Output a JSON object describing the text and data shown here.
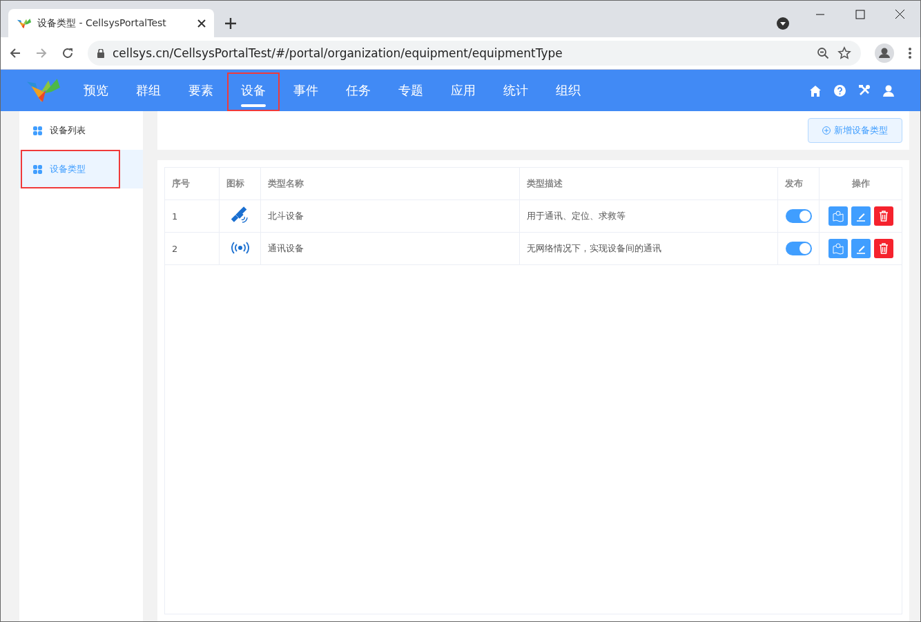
{
  "browser": {
    "tab_title": "设备类型 - CellsysPortalTest",
    "url": "cellsys.cn/CellsysPortalTest/#/portal/organization/equipment/equipmentType"
  },
  "nav": {
    "items": [
      {
        "label": "预览",
        "selected": false,
        "highlighted": false
      },
      {
        "label": "群组",
        "selected": false,
        "highlighted": false
      },
      {
        "label": "要素",
        "selected": false,
        "highlighted": false
      },
      {
        "label": "设备",
        "selected": true,
        "highlighted": true
      },
      {
        "label": "事件",
        "selected": false,
        "highlighted": false
      },
      {
        "label": "任务",
        "selected": false,
        "highlighted": false
      },
      {
        "label": "专题",
        "selected": false,
        "highlighted": false
      },
      {
        "label": "应用",
        "selected": false,
        "highlighted": false
      },
      {
        "label": "统计",
        "selected": false,
        "highlighted": false
      },
      {
        "label": "组织",
        "selected": false,
        "highlighted": false
      }
    ]
  },
  "sidebar": {
    "items": [
      {
        "label": "设备列表",
        "selected": false,
        "highlighted": false
      },
      {
        "label": "设备类型",
        "selected": true,
        "highlighted": true
      }
    ]
  },
  "toolbar": {
    "add_button": "新增设备类型"
  },
  "table": {
    "columns": [
      "序号",
      "图标",
      "类型名称",
      "类型描述",
      "发布",
      "操作"
    ],
    "rows": [
      {
        "index": "1",
        "kind": "satellite",
        "name": "北斗设备",
        "description": "用于通讯、定位、求救等",
        "published": true
      },
      {
        "index": "2",
        "kind": "signal",
        "name": "通讯设备",
        "description": "无网络情况下，实现设备间的通讯",
        "published": true
      }
    ]
  }
}
